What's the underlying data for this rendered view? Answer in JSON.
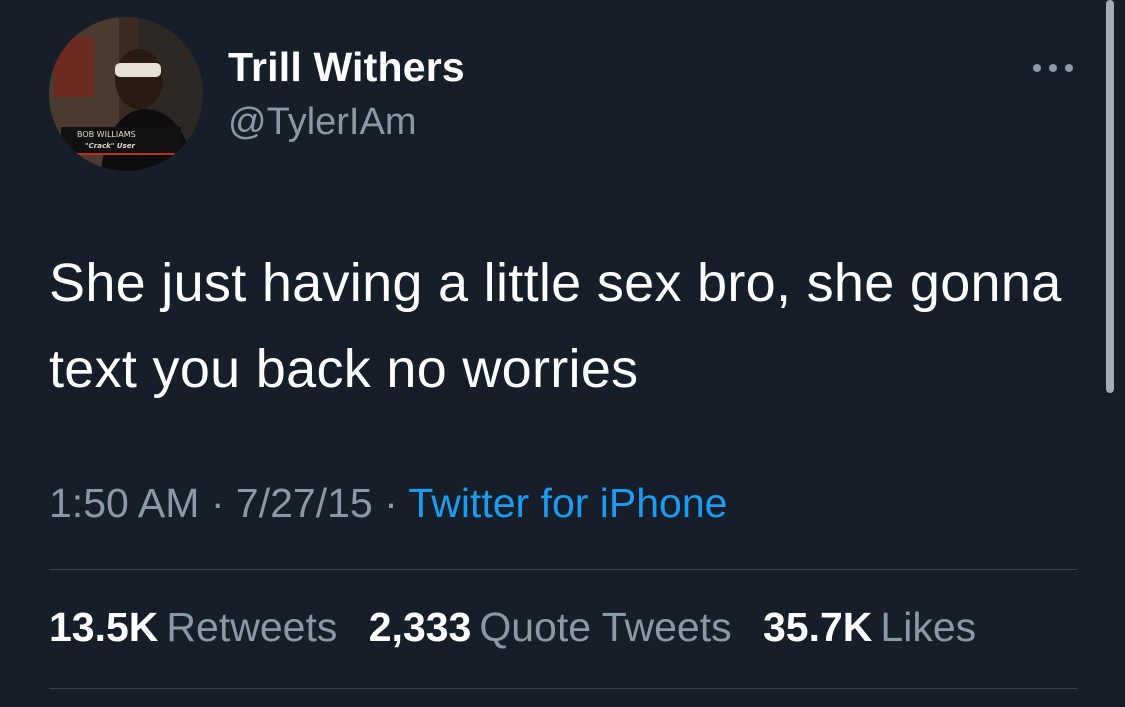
{
  "user": {
    "display_name": "Trill Withers",
    "handle": "@TylerIAm",
    "avatar_caption_name": "BOB WILLIAMS",
    "avatar_caption_sub": "\"Crack\" User"
  },
  "tweet": {
    "text": "She just having a little sex bro, she gonna text you back no worries",
    "time": "1:50 AM",
    "date": "7/27/15",
    "separator": "·",
    "source": "Twitter for iPhone"
  },
  "stats": {
    "retweets_count": "13.5K",
    "retweets_label": "Retweets",
    "quotes_count": "2,333",
    "quotes_label": "Quote Tweets",
    "likes_count": "35.7K",
    "likes_label": "Likes"
  },
  "icons": {
    "more": "more-horizontal-icon"
  },
  "colors": {
    "background": "#161e29",
    "secondary_text": "#8b98a5",
    "link": "#1d9bf0",
    "divider": "#38444d"
  }
}
